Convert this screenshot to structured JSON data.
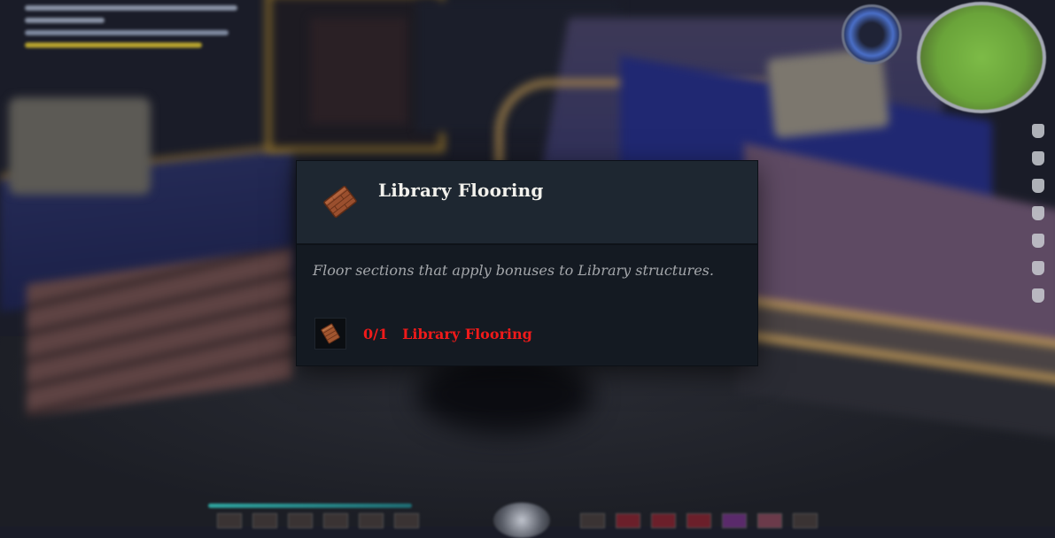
{
  "tooltip": {
    "title": "Library Flooring",
    "icon": "wood-floor-plank-icon",
    "description": "Floor sections that apply bonuses to Library structures.",
    "requirement": {
      "icon": "wood-floor-plank-icon",
      "count": "0/1",
      "item_name": "Library Flooring",
      "status_color": "#ef1a1a"
    }
  },
  "colors": {
    "tooltip_background": "#141a22",
    "tooltip_header": "#1e2731",
    "title_text": "#f2f1ec",
    "description_text": "#a4a7ab",
    "missing_requirement": "#ef1a1a"
  },
  "hud": {
    "minimap_icon": "minimap-icon",
    "compass_icon": "compass-icon"
  }
}
